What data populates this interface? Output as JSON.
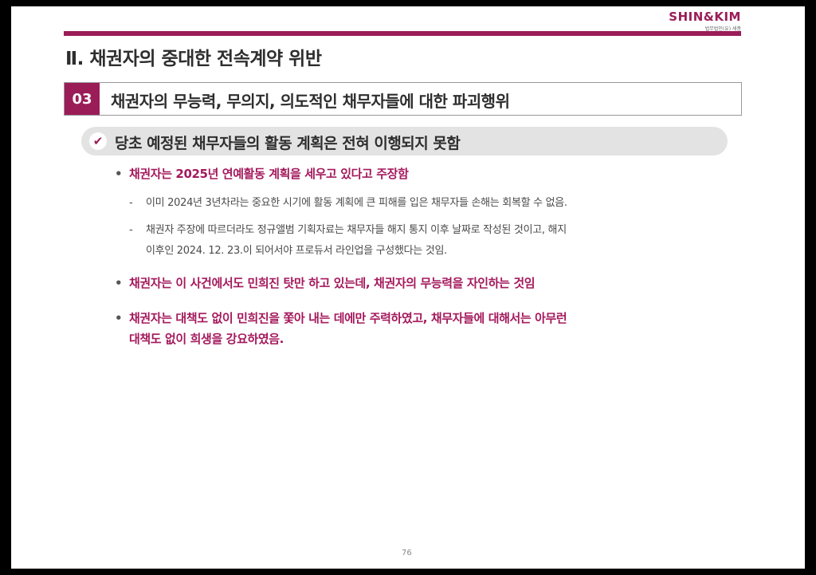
{
  "logo": {
    "main": "SHIN&KIM",
    "sub": "법무법인(유) 세종"
  },
  "title": "Ⅱ. 채권자의 중대한 전속계약 위반",
  "section": {
    "number": "03",
    "title": "채권자의 무능력, 무의지, 의도적인 채무자들에 대한 파괴행위"
  },
  "pill": {
    "text": "당초 예정된 채무자들의 활동 계획은 전혀 이행되지 못함"
  },
  "bullets": [
    {
      "marker": "•",
      "text": "채권자는 2025년 연예활동 계획을 세우고 있다고 주장함"
    },
    {
      "marker": "•",
      "text": "채권자는 이 사건에서도 민희진 탓만 하고 있는데, 채권자의 무능력을 자인하는 것임"
    },
    {
      "marker": "•",
      "line1": "채권자는 대책도 없이 민희진을 쫓아 내는 데에만 주력하였고, 채무자들에 대해서는 아무런",
      "line2": "대책도 없이 희생을 강요하였음."
    }
  ],
  "subs": [
    {
      "marker": "-",
      "text": "이미 2024년 3년차라는 중요한 시기에 활동 계획에 큰 피해를 입은 채무자들 손해는 회복할 수 없음."
    },
    {
      "marker": "-",
      "line1": "채권자 주장에 따르더라도 정규앨범 기획자료는 채무자들 해지 통지 이후 날짜로 작성된 것이고, 해지",
      "line2": "이후인 2024. 12. 23.이 되어서야 프로듀서 라인업을 구성했다는 것임."
    }
  ],
  "page_number": "76"
}
